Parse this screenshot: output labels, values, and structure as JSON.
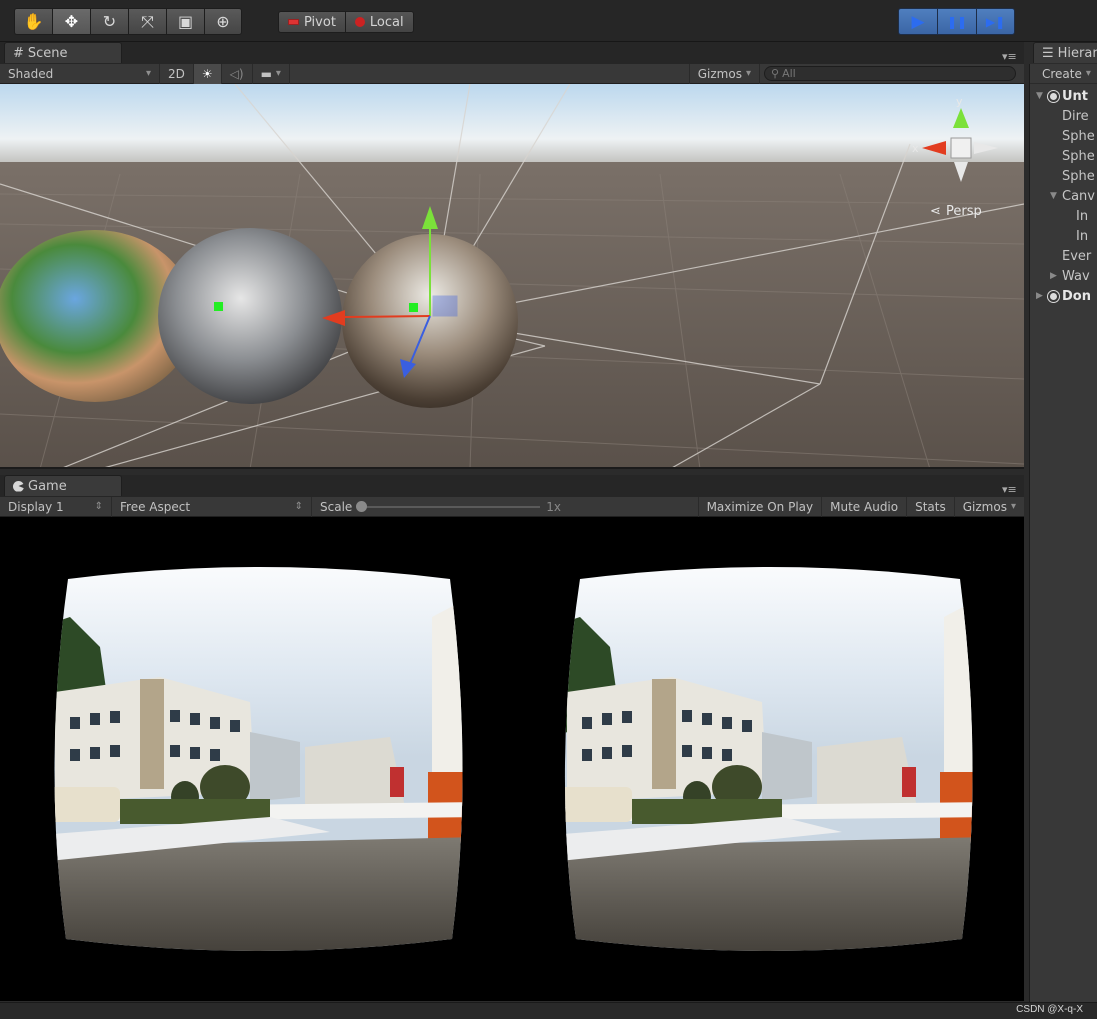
{
  "toolbar": {
    "tools": [
      {
        "name": "hand-tool",
        "glyph": "✋"
      },
      {
        "name": "move-tool",
        "glyph": "✥"
      },
      {
        "name": "rotate-tool",
        "glyph": "↻"
      },
      {
        "name": "scale-tool",
        "glyph": "⤧"
      },
      {
        "name": "rect-tool",
        "glyph": "▣"
      },
      {
        "name": "transform-tool",
        "glyph": "⊕"
      }
    ],
    "active_tool": "move-tool",
    "pivot_label": "Pivot",
    "local_label": "Local",
    "play_controls": [
      {
        "name": "play-button",
        "glyph": "▶"
      },
      {
        "name": "pause-button",
        "glyph": "❚❚"
      },
      {
        "name": "step-button",
        "glyph": "▶❚"
      }
    ],
    "play_active": true
  },
  "scene": {
    "tab_label": "Scene",
    "tab_icon": "#",
    "shading_mode": "Shaded",
    "mode_2d": "2D",
    "gizmos_label": "Gizmos",
    "search_placeholder": "All",
    "projection_label": "Persp",
    "gizmo_axes": {
      "x": "x",
      "y": "y"
    }
  },
  "game": {
    "tab_label": "Game",
    "display": "Display 1",
    "aspect": "Free Aspect",
    "scale_label": "Scale",
    "scale_value": "1x",
    "maximize_on_play": "Maximize On Play",
    "mute_audio": "Mute Audio",
    "stats": "Stats",
    "gizmos": "Gizmos"
  },
  "hierarchy": {
    "tab_label": "Hierar",
    "create_label": "Create",
    "rows": [
      {
        "label": "Unt",
        "indent": 0,
        "fold": "▼",
        "scene": true
      },
      {
        "label": "Dire",
        "indent": 1,
        "fold": ""
      },
      {
        "label": "Sphe",
        "indent": 1,
        "fold": ""
      },
      {
        "label": "Sphe",
        "indent": 1,
        "fold": ""
      },
      {
        "label": "Sphe",
        "indent": 1,
        "fold": ""
      },
      {
        "label": "Canv",
        "indent": 1,
        "fold": "▼"
      },
      {
        "label": "In",
        "indent": 2,
        "fold": ""
      },
      {
        "label": "In",
        "indent": 2,
        "fold": ""
      },
      {
        "label": "Ever",
        "indent": 1,
        "fold": ""
      },
      {
        "label": "Wav",
        "indent": 1,
        "fold": "▶"
      },
      {
        "label": "Don",
        "indent": 0,
        "fold": "▶",
        "scene": true
      }
    ]
  },
  "watermark": "CSDN @X-q-X",
  "colors": {
    "accent_blue": "#2c6cf0",
    "panel_bg": "#383838",
    "gizmo_x": "#e23c1f",
    "gizmo_y": "#7be13a",
    "gizmo_z": "#3a5fe0"
  }
}
